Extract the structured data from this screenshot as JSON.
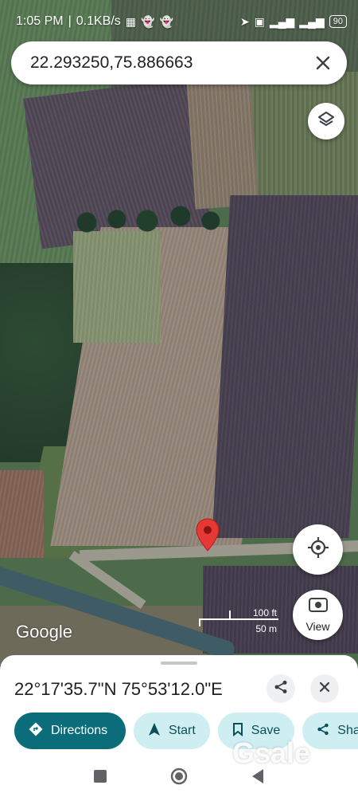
{
  "status_bar": {
    "time": "1:05 PM",
    "speed": "0.1KB/s",
    "battery": "90"
  },
  "search": {
    "value": "22.293250,75.886663"
  },
  "map": {
    "attribution": "Google",
    "scale_ft": "100 ft",
    "scale_m": "50 m",
    "marker_color": "#e53935"
  },
  "buttons": {
    "view_label": "View"
  },
  "place_sheet": {
    "coordinates": "22°17'35.7\"N 75°53'12.0\"E",
    "actions": [
      {
        "label": "Directions",
        "icon": "directions-icon"
      },
      {
        "label": "Start",
        "icon": "navigation-arrow-icon"
      },
      {
        "label": "Save",
        "icon": "bookmark-icon"
      },
      {
        "label": "Share",
        "icon": "share-icon"
      }
    ]
  },
  "watermark": "Gsale",
  "colors": {
    "primary_chip": "#0b6d79",
    "secondary_chip": "#cfeef2"
  }
}
